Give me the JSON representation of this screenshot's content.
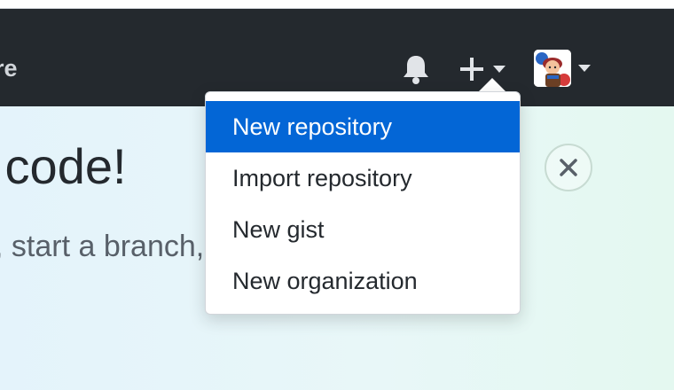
{
  "header": {
    "nav_partial": "lore",
    "icons": {
      "bell": "bell-icon",
      "plus": "plus-icon",
      "caret": "chevron-down-icon"
    },
    "avatar": "user-avatar"
  },
  "dropdown": {
    "items": [
      {
        "label": "New repository",
        "active": true
      },
      {
        "label": "Import repository",
        "active": false
      },
      {
        "label": "New gist",
        "active": false
      },
      {
        "label": "New organization",
        "active": false
      }
    ]
  },
  "hero": {
    "title_partial": "y code!",
    "subtitle_partial": ", start a branch,"
  },
  "colors": {
    "header_bg": "#24292e",
    "menu_active_bg": "#0366d6",
    "menu_text": "#24292e",
    "hero_text": "#24292e",
    "hero_subtext": "#586069"
  }
}
